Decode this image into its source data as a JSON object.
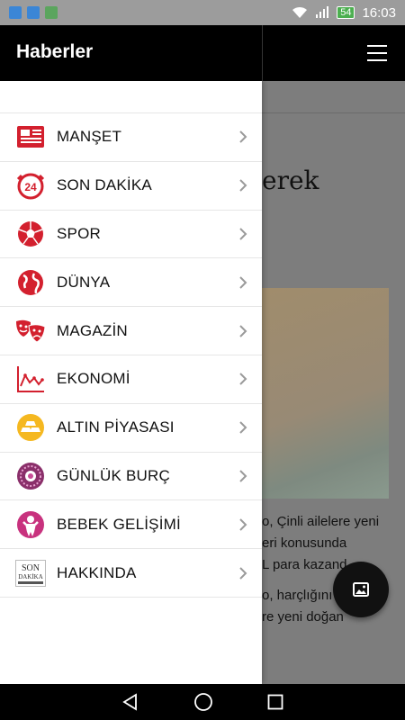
{
  "status_bar": {
    "time": "16:03",
    "battery": "54"
  },
  "app_bar": {
    "title": "Haberler"
  },
  "background_article": {
    "title_fragment": "erek",
    "text_lines": [
      "o, Çinli ailelere yeni",
      "eri konusunda",
      "L para kazand",
      "o, harçlığını",
      "re yeni doğan"
    ]
  },
  "menu": {
    "items": [
      {
        "label": "MANŞET",
        "icon": "newspaper-icon"
      },
      {
        "label": "SON DAKİKA",
        "icon": "clock-24-icon"
      },
      {
        "label": "SPOR",
        "icon": "soccer-ball-icon"
      },
      {
        "label": "DÜNYA",
        "icon": "globe-icon"
      },
      {
        "label": "MAGAZİN",
        "icon": "theater-masks-icon"
      },
      {
        "label": "EKONOMİ",
        "icon": "line-chart-icon"
      },
      {
        "label": "ALTIN PİYASASI",
        "icon": "gold-bars-icon"
      },
      {
        "label": "GÜNLÜK BURÇ",
        "icon": "zodiac-icon"
      },
      {
        "label": "BEBEK GELİŞİMİ",
        "icon": "baby-icon"
      },
      {
        "label": "HAKKINDA",
        "icon": "son-dakika-logo-icon",
        "logo_text": [
          "SON",
          "DAKİKA"
        ]
      }
    ]
  },
  "colors": {
    "accent": "#d3202e",
    "app_bar": "#000000",
    "gold": "#f5b820"
  }
}
